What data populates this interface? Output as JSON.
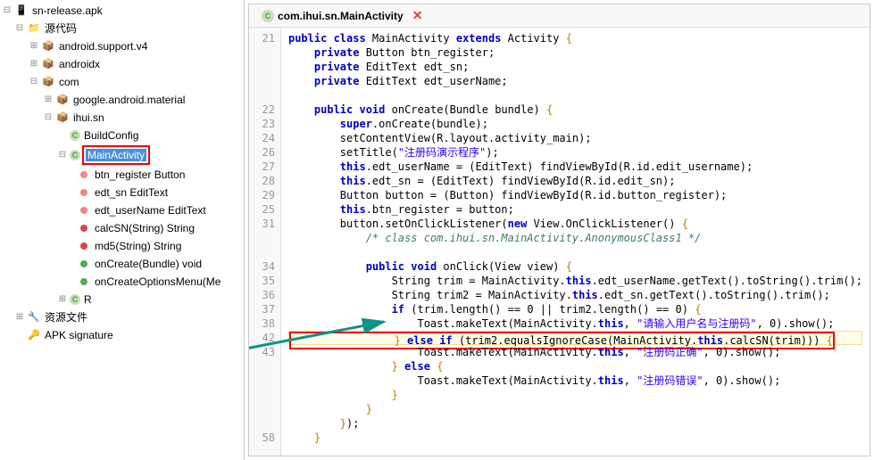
{
  "tree": {
    "root": "sn-release.apk",
    "source": "源代码",
    "pkg_asv4": "android.support.v4",
    "pkg_androidx": "androidx",
    "pkg_com": "com",
    "pkg_gam": "google.android.material",
    "pkg_ihui": "ihui.sn",
    "cls_buildconfig": "BuildConfig",
    "cls_mainactivity": "MainActivity",
    "fld_btn": "btn_register Button",
    "fld_sn": "edt_sn EditText",
    "fld_un": "edt_userName EditText",
    "m_calc": "calcSN(String) String",
    "m_md5": "md5(String) String",
    "m_onc": "onCreate(Bundle) void",
    "m_oncom": "onCreateOptionsMenu(Me",
    "cls_r": "R",
    "resources": "资源文件",
    "apk_sig": "APK signature"
  },
  "tab": {
    "label": "com.ihui.sn.MainActivity"
  },
  "code": {
    "lines": [
      {
        "n": 21,
        "t": "<span class='kw'>public</span> <span class='kw'>class</span> MainActivity <span class='kw'>extends</span> Activity <span class='brace'>{</span>"
      },
      {
        "n": "",
        "t": "    <span class='kw'>private</span> Button btn_register;"
      },
      {
        "n": "",
        "t": "    <span class='kw'>private</span> EditText edt_sn;"
      },
      {
        "n": "",
        "t": "    <span class='kw'>private</span> EditText edt_userName;"
      },
      {
        "n": "",
        "t": ""
      },
      {
        "n": 22,
        "t": "    <span class='kw'>public</span> <span class='kw'>void</span> onCreate(Bundle bundle) <span class='brace'>{</span>"
      },
      {
        "n": 23,
        "t": "        <span class='kw'>super</span>.onCreate(bundle);"
      },
      {
        "n": 24,
        "t": "        setContentView(R.layout.<span class='pun'>activity_main</span>);"
      },
      {
        "n": 26,
        "t": "        setTitle(<span class='str'>\"注册码演示程序\"</span>);"
      },
      {
        "n": 27,
        "t": "        <span class='kw'>this</span>.edt_userName = (EditText) findViewById(R.id.<span class='pun'>edit_username</span>);"
      },
      {
        "n": 28,
        "t": "        <span class='kw'>this</span>.edt_sn = (EditText) findViewById(R.id.<span class='pun'>edit_sn</span>);"
      },
      {
        "n": 29,
        "t": "        Button button = (Button) findViewById(R.id.<span class='pun'>button_register</span>);"
      },
      {
        "n": 25,
        "t": "        <span class='kw'>this</span>.btn_register = button;"
      },
      {
        "n": 31,
        "t": "        button.setOnClickListener(<span class='kw'>new</span> View.OnClickListener() <span class='brace'>{</span>"
      },
      {
        "n": "",
        "t": "            <span class='cmt'>/* class com.ihui.sn.MainActivity.AnonymousClass1 */</span>"
      },
      {
        "n": "",
        "t": ""
      },
      {
        "n": 34,
        "t": "            <span class='kw'>public</span> <span class='kw'>void</span> onClick(View view) <span class='brace'>{</span>"
      },
      {
        "n": 35,
        "t": "                String trim = MainActivity.<span class='kw'>this</span>.edt_userName.getText().toString().trim();"
      },
      {
        "n": 36,
        "t": "                String trim2 = MainActivity.<span class='kw'>this</span>.edt_sn.getText().toString().trim();"
      },
      {
        "n": 37,
        "t": "                <span class='kw'>if</span> (trim.length() == <span class='num'>0</span> || trim2.length() == <span class='num'>0</span>) <span class='brace'>{</span>"
      },
      {
        "n": 38,
        "t": "                    Toast.makeText(MainActivity.<span class='kw'>this</span>, <span class='str'>\"请输入用户名与注册码\"</span>, <span class='num'>0</span>).show();"
      },
      {
        "n": 42,
        "t": "                <span class='brace'>}</span> <span class='kw'>else</span> <span class='kw'>if</span> (trim2.equalsIgnoreCase(MainActivity.<span class='kw'>this</span>.calcSN(trim))) <span class='brace'>{</span>",
        "hl": true,
        "box": true
      },
      {
        "n": 43,
        "t": "                    Toast.makeText(MainActivity.<span class='kw'>this</span>, <span class='str'>\"注册码正确\"</span>, <span class='num'>0</span>).show();"
      },
      {
        "n": "",
        "t": "                <span class='brace'>}</span> <span class='kw'>else</span> <span class='brace'>{</span>"
      },
      {
        "n": "",
        "t": "                    Toast.makeText(MainActivity.<span class='kw'>this</span>, <span class='str'>\"注册码错误\"</span>, <span class='num'>0</span>).show();"
      },
      {
        "n": "",
        "t": "                <span class='brace'>}</span>"
      },
      {
        "n": "",
        "t": "            <span class='brace'>}</span>"
      },
      {
        "n": "",
        "t": "        <span class='brace'>}</span>);"
      },
      {
        "n": "58",
        "t": "    <span class='brace'>}</span>"
      }
    ]
  }
}
